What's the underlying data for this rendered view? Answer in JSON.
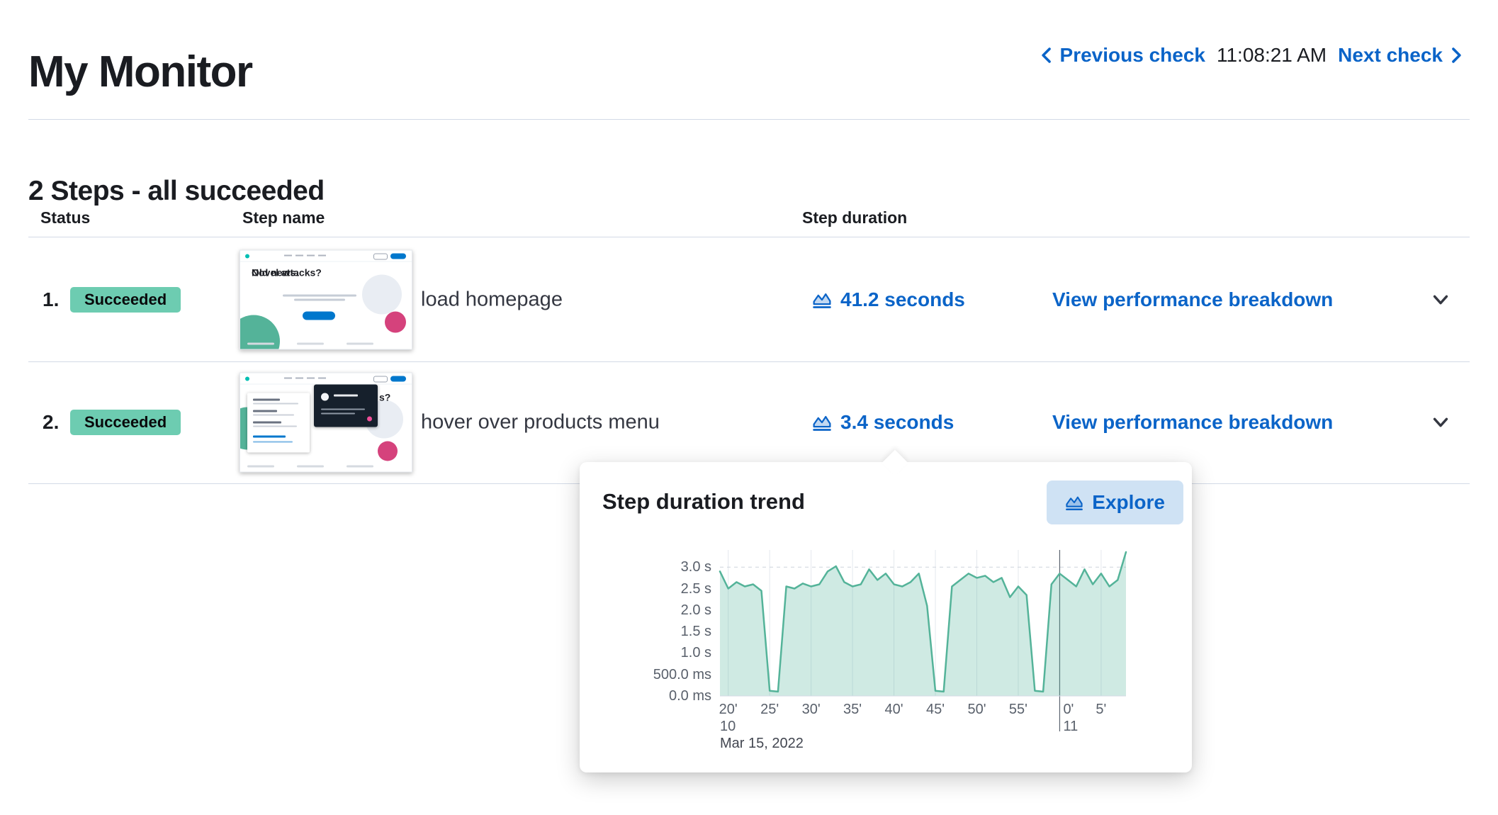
{
  "header": {
    "title": "My Monitor",
    "previous_check_label": "Previous check",
    "check_time": "11:08:21 AM",
    "next_check_label": "Next check"
  },
  "steps_section": {
    "heading": "2 Steps - all succeeded",
    "columns": {
      "status": "Status",
      "step_name": "Step name",
      "step_duration": "Step duration"
    },
    "rows": [
      {
        "index": "1.",
        "status": "Succeeded",
        "name": "load homepage",
        "duration": "41.2 seconds",
        "action": "View performance breakdown",
        "thumbnail": {
          "headline_line1": "Novel attacks?",
          "headline_line2": "Old news."
        }
      },
      {
        "index": "2.",
        "status": "Succeeded",
        "name": "hover over products menu",
        "duration": "3.4 seconds",
        "action": "View performance breakdown",
        "thumbnail": {
          "text_fragment": "s?"
        }
      }
    ]
  },
  "popover": {
    "title": "Step duration trend",
    "explore_label": "Explore"
  },
  "chart_data": {
    "type": "area",
    "title": "Step duration trend",
    "legend": "none",
    "grid": "vertical minute gridlines, dashed top line at 3.0 s",
    "x_axis_unit": "time of day, minutes past the hour",
    "y_axis_unit": "step duration",
    "x_domain_minutes": [
      19,
      68
    ],
    "y_max_seconds": 3.4,
    "values_seconds": [
      2.9,
      2.5,
      2.65,
      2.55,
      2.6,
      2.45,
      0.12,
      0.1,
      2.55,
      2.5,
      2.62,
      2.55,
      2.6,
      2.9,
      3.02,
      2.65,
      2.55,
      2.6,
      2.95,
      2.7,
      2.85,
      2.6,
      2.55,
      2.65,
      2.85,
      2.1,
      0.12,
      0.1,
      2.55,
      2.7,
      2.85,
      2.75,
      2.8,
      2.65,
      2.75,
      2.3,
      2.55,
      2.35,
      0.12,
      0.1,
      2.6,
      2.85,
      2.7,
      2.55,
      2.95,
      2.6,
      2.85,
      2.55,
      2.7,
      3.35
    ],
    "y_ticks": [
      {
        "label": "3.0 s",
        "seconds": 3.0
      },
      {
        "label": "2.5 s",
        "seconds": 2.5
      },
      {
        "label": "2.0 s",
        "seconds": 2.0
      },
      {
        "label": "1.5 s",
        "seconds": 1.5
      },
      {
        "label": "1.0 s",
        "seconds": 1.0
      },
      {
        "label": "500.0 ms",
        "seconds": 0.5
      },
      {
        "label": "0.0 ms",
        "seconds": 0.0
      }
    ],
    "x_ticks": [
      {
        "label": "20'",
        "minute": 20
      },
      {
        "label": "25'",
        "minute": 25
      },
      {
        "label": "30'",
        "minute": 30
      },
      {
        "label": "35'",
        "minute": 35
      },
      {
        "label": "40'",
        "minute": 40
      },
      {
        "label": "45'",
        "minute": 45
      },
      {
        "label": "50'",
        "minute": 50
      },
      {
        "label": "55'",
        "minute": 55
      },
      {
        "label": "0'",
        "minute": 60,
        "align": "left"
      },
      {
        "label": "5'",
        "minute": 65
      }
    ],
    "hour_ticks": [
      {
        "label": "10",
        "minute": 19
      },
      {
        "label": "11",
        "minute": 60,
        "align": "left"
      }
    ],
    "date_label": "Mar 15, 2022",
    "hour_line_minute": 60,
    "v_gridlines_minutes": [
      20,
      25,
      30,
      35,
      40,
      45,
      50,
      55,
      65
    ],
    "dashed_line_seconds": 3.0
  },
  "colors": {
    "link_blue": "#0b64c8",
    "badge_green": "#6dccb1",
    "chart_line_green": "#54b399",
    "chart_fill_green": "rgba(84,179,153,0.28)",
    "explore_button_bg": "#cfe2f4",
    "divider": "#d3dae6"
  },
  "icons": {
    "previous": "chevron-left",
    "next": "chevron-right",
    "duration": "area-chart",
    "expand_row": "chevron-down",
    "explore": "area-chart"
  }
}
